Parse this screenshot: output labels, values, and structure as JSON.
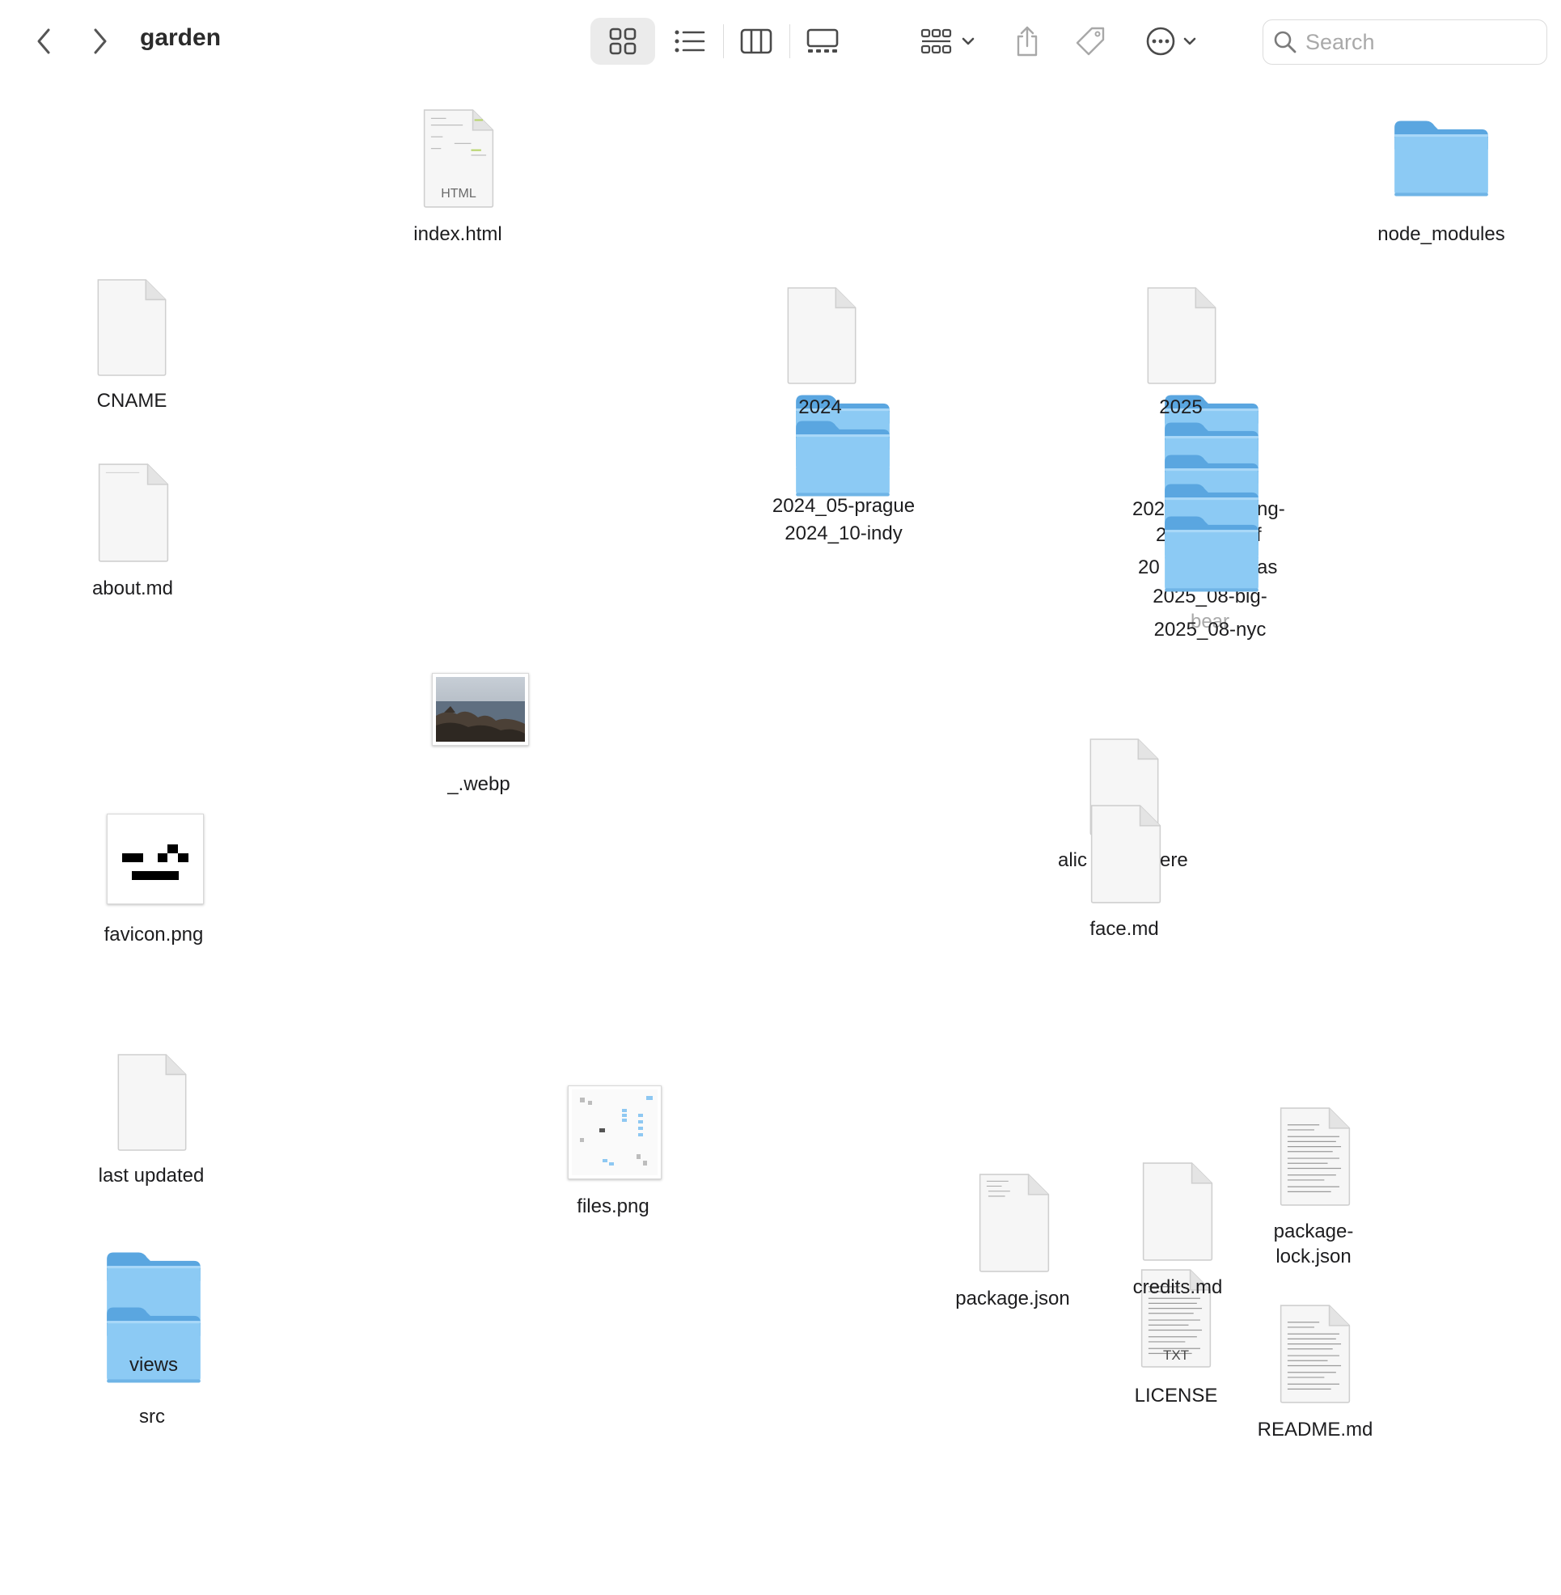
{
  "window": {
    "title": "garden"
  },
  "toolbar": {
    "search_placeholder": "Search"
  },
  "items": {
    "index_html": {
      "name": "index.html",
      "badge": "HTML"
    },
    "node_modules": {
      "name": "node_modules"
    },
    "cname": {
      "name": "CNAME"
    },
    "about_md": {
      "name": "about.md"
    },
    "year_2024": {
      "name": "2024"
    },
    "year_2025": {
      "name": "2025"
    },
    "prague": {
      "name": "2024_05-prague"
    },
    "indy": {
      "name": "2024_10-indy"
    },
    "stack_2025": {
      "line1a": "202",
      "line1b": "ng-",
      "line2a": "2",
      "line2b": "f",
      "line3a": "20",
      "line3b": "as",
      "line4": "2025_08-big-",
      "line5": "bear",
      "line6": "2025_08-nyc"
    },
    "webp": {
      "name": "_.webp"
    },
    "favicon": {
      "name": "favicon.png"
    },
    "overlap": {
      "left": "alic",
      "right": "ere"
    },
    "face_md": {
      "name": "face.md"
    },
    "last_updated": {
      "name": "last updated"
    },
    "files_png": {
      "name": "files.png"
    },
    "package_json": {
      "name": "package.json"
    },
    "credits_md": {
      "name": "credits.md"
    },
    "package_lock": {
      "name": "package-lock.json"
    },
    "license": {
      "name": "LICENSE",
      "badge": "TXT"
    },
    "readme": {
      "name": "README.md"
    },
    "src": {
      "name": "src"
    },
    "views": {
      "name": "views"
    }
  },
  "colors": {
    "folder_front": "#8ccaf4",
    "folder_back": "#5aa6e0",
    "accent": "#1d1d1f"
  }
}
